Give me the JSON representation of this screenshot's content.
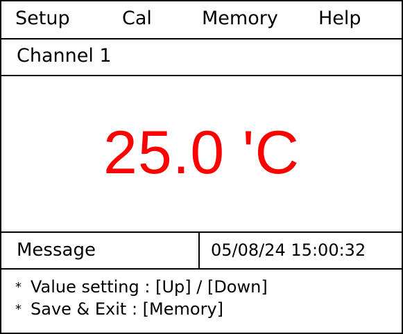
{
  "menu": {
    "setup": "Setup",
    "cal": "Cal",
    "memory": "Memory",
    "help": "Help"
  },
  "channel": {
    "label": "Channel 1"
  },
  "reading": {
    "value": "25.0 'C",
    "color": "#ff0000"
  },
  "status": {
    "message_label": "Message",
    "datetime": "05/08/24 15:00:32"
  },
  "hints": {
    "bullet": "*",
    "line1": "Value setting : [Up] / [Down]",
    "line2": "Save & Exit : [Memory]"
  }
}
